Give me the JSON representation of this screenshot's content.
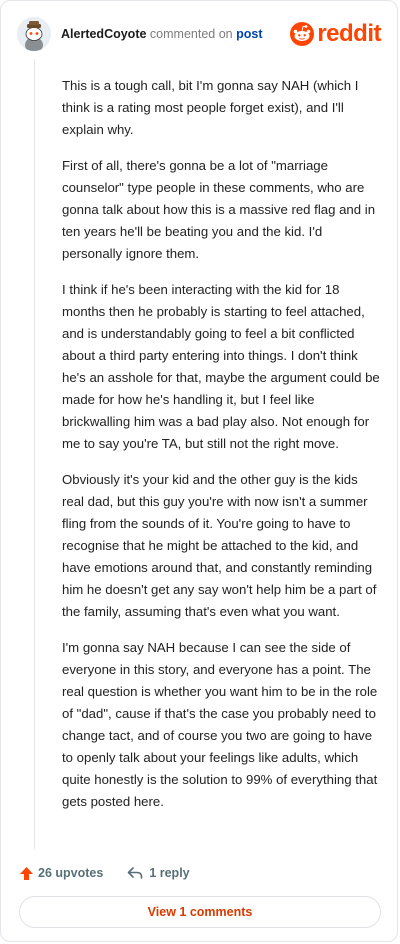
{
  "comment": {
    "author": "AlertedCoyote",
    "action": "commented on",
    "post_link": "post",
    "brand": "reddit",
    "paragraphs": [
      "This is a tough call, bit I'm gonna say NAH (which I think is a rating most people forget exist), and I'll explain why.",
      "First of all, there's gonna be a lot of \"marriage counselor\" type people in these comments, who are gonna talk about how this is a massive red flag and in ten years he'll be beating you and the kid. I'd personally ignore them.",
      "I think if he's been interacting with the kid for 18 months then he probably is starting to feel attached, and is understandably going to feel a bit conflicted about a third party entering into things. I don't think he's an asshole for that, maybe the argument could be made for how he's handling it, but I feel like brickwalling him was a bad play also. Not enough for me to say you're TA, but still not the right move.",
      "Obviously it's your kid and the other guy is the kids real dad, but this guy you're with now isn't a summer fling from the sounds of it. You're going to have to recognise that he might be attached to the kid, and have emotions around that, and constantly reminding him he doesn't get any say won't help him be a part of the family, assuming that's even what you want.",
      "I'm gonna say NAH because I can see the side of everyone in this story, and everyone has a point. The real question is whether you want him to be in the role of \"dad\", cause if that's the case you probably need to change tact, and of course you two are going to have to openly talk about your feelings like adults, which quite honestly is the solution to 99% of everything that gets posted here."
    ],
    "upvotes": "26 upvotes",
    "replies": "1 reply",
    "view_comments": "View 1 comments"
  },
  "icons": {
    "avatar": "snoo-avatar-icon",
    "logo": "reddit-snoo-icon",
    "upvote": "upvote-arrow-icon",
    "reply": "reply-arrow-icon"
  },
  "colors": {
    "brand": "#ff4500",
    "link": "#0045ac",
    "upvote": "#ff4500",
    "view_button_text": "#d93a00"
  }
}
